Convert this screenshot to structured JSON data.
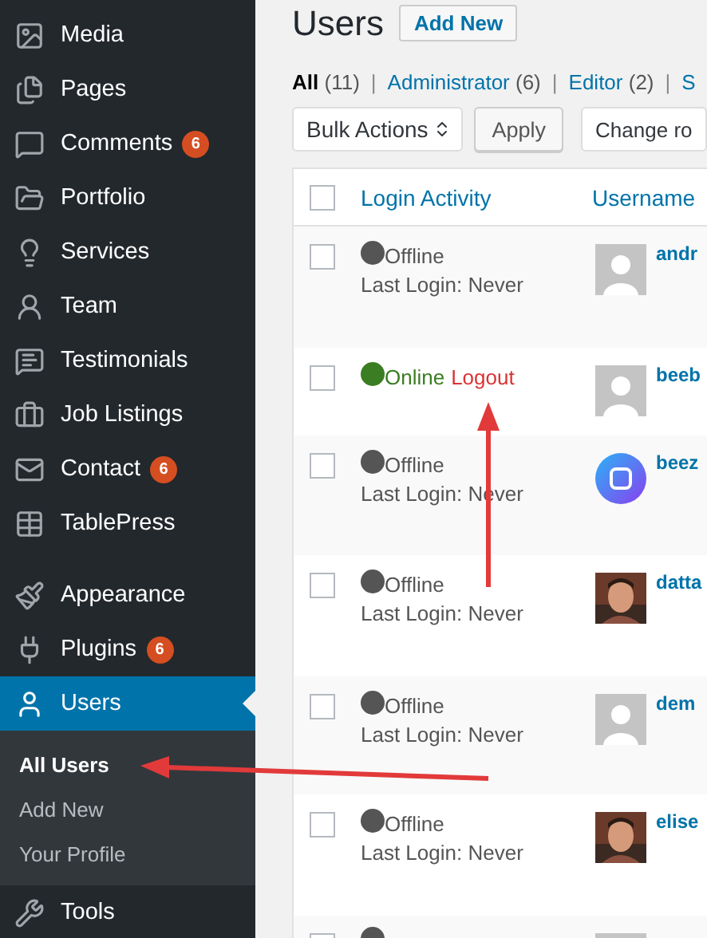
{
  "sidebar": {
    "groups": [
      [
        {
          "label": "Media"
        },
        {
          "label": "Pages"
        },
        {
          "label": "Comments",
          "badge": "6"
        },
        {
          "label": "Portfolio"
        },
        {
          "label": "Services"
        },
        {
          "label": "Team"
        },
        {
          "label": "Testimonials"
        },
        {
          "label": "Job Listings"
        },
        {
          "label": "Contact",
          "badge": "6"
        },
        {
          "label": "TablePress"
        }
      ],
      [
        {
          "label": "Appearance"
        },
        {
          "label": "Plugins",
          "badge": "6"
        },
        {
          "label": "Users",
          "selected": true,
          "children": [
            {
              "label": "All Users",
              "selected": true
            },
            {
              "label": "Add New",
              "selected": false
            },
            {
              "label": "Your Profile",
              "selected": false
            }
          ]
        },
        {
          "label": "Tools"
        }
      ]
    ]
  },
  "page": {
    "title": "Users",
    "add_button": "Add New"
  },
  "filters": [
    {
      "label": "All",
      "count": "(11)",
      "selected": true
    },
    {
      "separator": "|",
      "label": "Administrator",
      "count": "(6)",
      "selected": false
    },
    {
      "separator": "|",
      "label": "Editor",
      "count": "(2)",
      "selected": false
    },
    {
      "separator": "|",
      "label": "S",
      "selected": false
    }
  ],
  "actions": {
    "bulk": "Bulk Actions",
    "apply": "Apply",
    "change_role": "Change ro"
  },
  "table": {
    "columns": [
      "Login Activity",
      "Username"
    ],
    "select_all": {
      "checked": false
    },
    "rows": [
      {
        "checked": false,
        "online": false,
        "status_label": "Offline",
        "last_login": "Last Login: Never",
        "avatar": {
          "kind": "default"
        },
        "username": "andr"
      },
      {
        "checked": false,
        "online": true,
        "status_label": "Online",
        "logout": "Logout",
        "avatar": {
          "kind": "default"
        },
        "username": "beeb"
      },
      {
        "checked": false,
        "online": false,
        "status_label": "Offline",
        "last_login": "Last Login: Never",
        "avatar": {
          "kind": "logo"
        },
        "username": "beez"
      },
      {
        "checked": false,
        "online": false,
        "status_label": "Offline",
        "last_login": "Last Login: Never",
        "username": "datta"
      },
      {
        "checked": false,
        "online": false,
        "status_label": "Offline",
        "last_login": "Last Login: Never",
        "avatar": {
          "kind": "default"
        },
        "username": "dem"
      },
      {
        "checked": false,
        "online": false,
        "status_label": "Offline",
        "last_login": "Last Login: Never",
        "username": "elise"
      },
      {
        "checked": false,
        "online": false,
        "avatar": {
          "kind": "default"
        }
      }
    ]
  }
}
